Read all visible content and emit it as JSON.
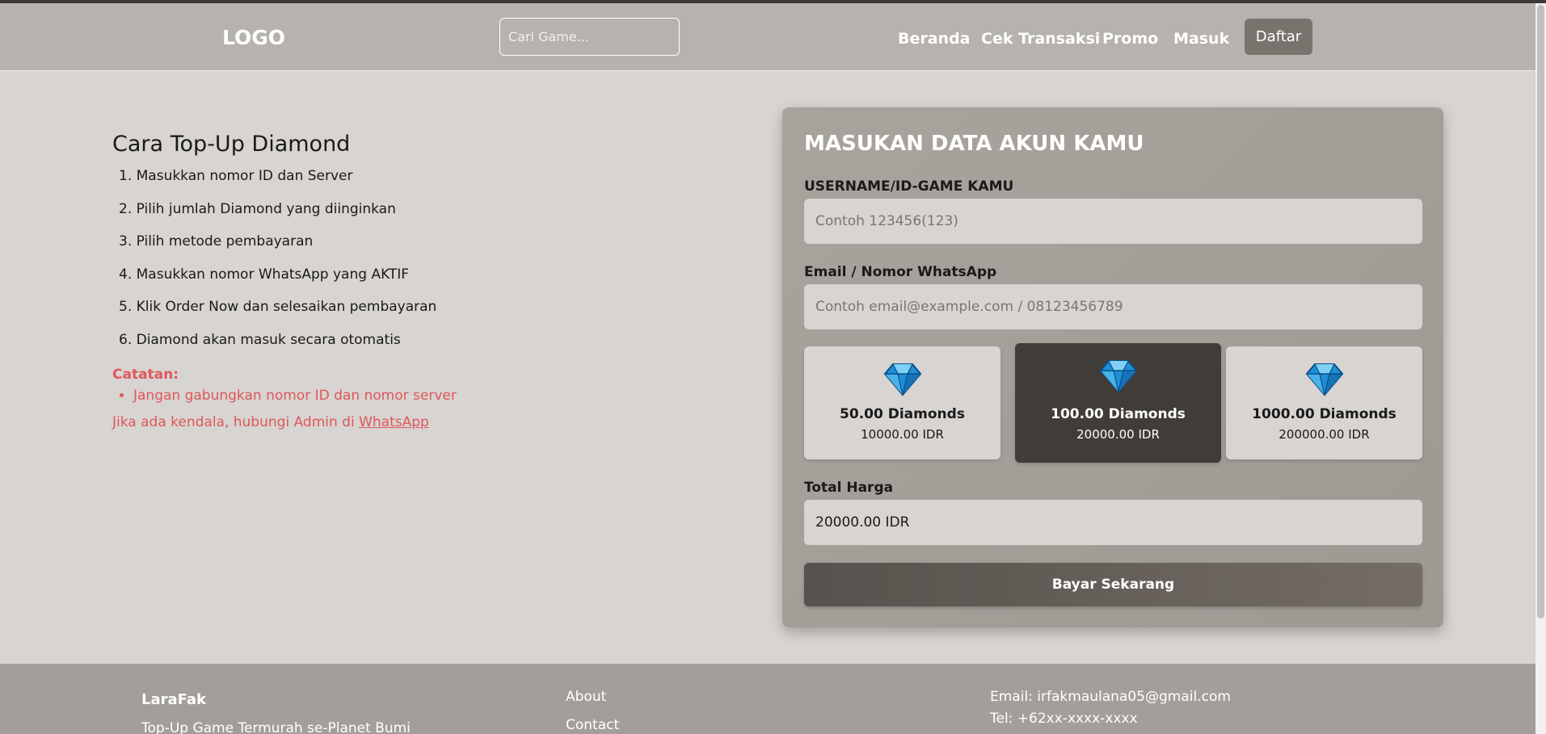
{
  "header": {
    "logo": "LOGO",
    "search_placeholder": "Cari Game...",
    "nav": [
      "Beranda",
      "Cek Transaksi",
      "Promo",
      "Masuk"
    ],
    "register_label": "Daftar"
  },
  "guide": {
    "title": "Cara Top-Up Diamond",
    "steps": [
      "1. Masukkan nomor ID dan Server",
      "2. Pilih jumlah Diamond yang diinginkan",
      "3. Pilih metode pembayaran",
      "4. Masukkan nomor WhatsApp yang AKTIF",
      "5. Klik Order Now dan selesaikan pembayaran",
      "6. Diamond akan masuk secara otomatis"
    ],
    "note_title": "Catatan:",
    "notes": [
      "Jangan gabungkan nomor ID dan nomor server"
    ],
    "contact_text": "Jika ada kendala, hubungi Admin di ",
    "contact_link": "WhatsApp"
  },
  "form": {
    "title": "MASUKAN DATA AKUN KAMU",
    "username_label": "USERNAME/ID-GAME KAMU",
    "username_placeholder": "Contoh 123456(123)",
    "contact_label": "Email / Nomor WhatsApp",
    "contact_placeholder": "Contoh email@example.com / 08123456789",
    "packages": [
      {
        "amount": "50.00 Diamonds",
        "price": "10000.00 IDR",
        "selected": false
      },
      {
        "amount": "100.00 Diamonds",
        "price": "20000.00 IDR",
        "selected": true
      },
      {
        "amount": "1000.00 Diamonds",
        "price": "200000.00 IDR",
        "selected": false
      }
    ],
    "total_label": "Total Harga",
    "total_value": "20000.00 IDR",
    "pay_label": "Bayar Sekarang"
  },
  "footer": {
    "brand": "LaraFak",
    "tagline": "Top-Up Game Termurah se-Planet Bumi",
    "links": [
      "About",
      "Contact"
    ],
    "email": "Email: irfakmaulana05@gmail.com",
    "phone": "Tel: +62xx-xxxx-xxxx"
  },
  "colors": {
    "navbar": "#b6b2ae",
    "page_bg": "#d7d4d1",
    "card_bg": "#a8a39d",
    "selected_package": "#403c38",
    "note_red": "#e0575b",
    "footer": "#a39e99"
  }
}
